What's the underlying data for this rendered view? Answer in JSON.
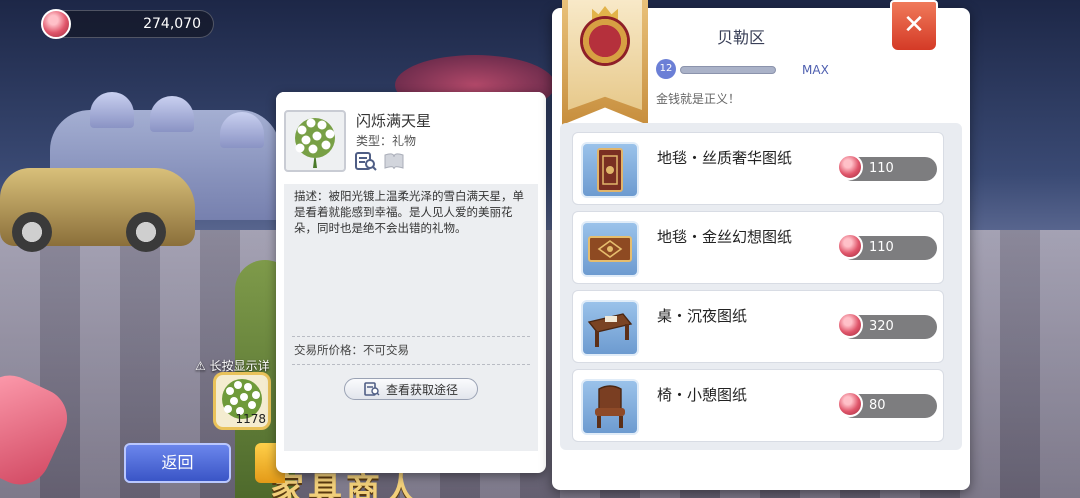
{
  "currency": {
    "amount": "274,070",
    "icon": "zeny-coin-icon"
  },
  "hint": {
    "text": "⚠ 长按显示详"
  },
  "held_item": {
    "count": "1178"
  },
  "buttons": {
    "back_label": "返回"
  },
  "shop_title": "家具商人",
  "tooltip": {
    "item_name": "闪烁满天星",
    "item_type": "类型：礼物",
    "description": "描述：被阳光镀上温柔光泽的雪白满天星，单是看着就能感到幸福。是人见人爱的美丽花朵，同时也是绝不会出错的礼物。",
    "trade_price": "交易所价格：不可交易",
    "source_button": "查看获取途径"
  },
  "shop": {
    "title": "贝勒区",
    "level": "12",
    "level_status": "MAX",
    "level_progress": 1.0,
    "motto": "金钱就是正义！",
    "close_label": "✕",
    "items": [
      {
        "name": "地毯・丝质奢华图纸",
        "price": "110",
        "icon": "carpet-silk-icon"
      },
      {
        "name": "地毯・金丝幻想图纸",
        "price": "110",
        "icon": "carpet-gold-icon"
      },
      {
        "name": "桌・沉夜图纸",
        "price": "320",
        "icon": "table-icon"
      },
      {
        "name": "椅・小憩图纸",
        "price": "80",
        "icon": "chair-icon"
      }
    ]
  },
  "colors": {
    "accent_blue": "#3a55c6",
    "close_red": "#d43a26",
    "gold": "#e39a18"
  }
}
